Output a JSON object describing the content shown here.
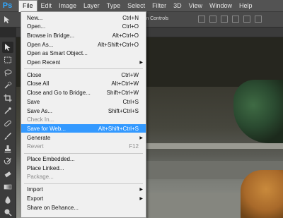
{
  "app": {
    "logo": "Ps"
  },
  "menubar": {
    "items": [
      "File",
      "Edit",
      "Image",
      "Layer",
      "Type",
      "Select",
      "Filter",
      "3D",
      "View",
      "Window",
      "Help"
    ]
  },
  "options_bar": {
    "label": "rm Controls"
  },
  "file_menu": {
    "groups": [
      [
        {
          "label": "New...",
          "shortcut": "Ctrl+N"
        },
        {
          "label": "Open...",
          "shortcut": "Ctrl+O"
        },
        {
          "label": "Browse in Bridge...",
          "shortcut": "Alt+Ctrl+O"
        },
        {
          "label": "Open As...",
          "shortcut": "Alt+Shift+Ctrl+O"
        },
        {
          "label": "Open as Smart Object...",
          "shortcut": ""
        },
        {
          "label": "Open Recent",
          "shortcut": "",
          "submenu": true
        }
      ],
      [
        {
          "label": "Close",
          "shortcut": "Ctrl+W"
        },
        {
          "label": "Close All",
          "shortcut": "Alt+Ctrl+W"
        },
        {
          "label": "Close and Go to Bridge...",
          "shortcut": "Shift+Ctrl+W"
        },
        {
          "label": "Save",
          "shortcut": "Ctrl+S"
        },
        {
          "label": "Save As...",
          "shortcut": "Shift+Ctrl+S"
        },
        {
          "label": "Check In...",
          "shortcut": "",
          "disabled": true
        },
        {
          "label": "Save for Web...",
          "shortcut": "Alt+Shift+Ctrl+S",
          "highlighted": true
        },
        {
          "label": "Generate",
          "shortcut": "",
          "submenu": true
        },
        {
          "label": "Revert",
          "shortcut": "F12",
          "disabled": true
        }
      ],
      [
        {
          "label": "Place Embedded...",
          "shortcut": ""
        },
        {
          "label": "Place Linked...",
          "shortcut": ""
        },
        {
          "label": "Package...",
          "shortcut": "",
          "disabled": true
        }
      ],
      [
        {
          "label": "Import",
          "shortcut": "",
          "submenu": true
        },
        {
          "label": "Export",
          "shortcut": "",
          "submenu": true
        },
        {
          "label": "Share on Behance...",
          "shortcut": ""
        }
      ]
    ]
  },
  "toolbox": {
    "tools": [
      "move-tool",
      "marquee-tool",
      "lasso-tool",
      "quick-select-tool",
      "crop-tool",
      "eyedropper-tool",
      "healing-brush-tool",
      "brush-tool",
      "clone-stamp-tool",
      "history-brush-tool",
      "eraser-tool",
      "gradient-tool",
      "blur-tool",
      "dodge-tool",
      "pen-tool"
    ]
  },
  "colors": {
    "menu_bg": "#f0f0f0",
    "highlight": "#3399ff",
    "chrome_dark": "#3c3c3c",
    "ps_blue": "#31a8ff"
  }
}
